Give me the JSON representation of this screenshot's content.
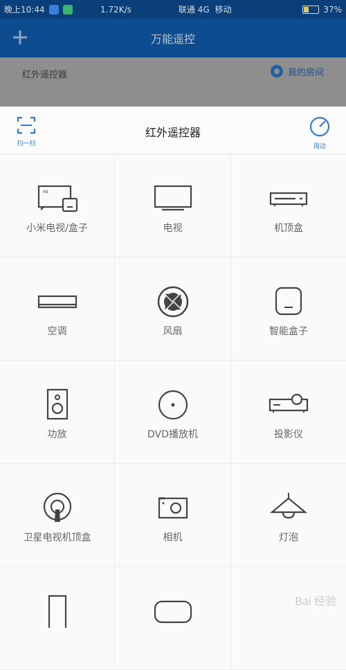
{
  "status_bar": {
    "time": "晚上10:44",
    "speed": "1.72K/s",
    "carrier1": "联通 4G",
    "carrier2": "移动",
    "battery": "37%",
    "battery_level": 0.37
  },
  "appbar": {
    "title": "万能遥控"
  },
  "subbar": {
    "title": "红外遥控器",
    "room_label": "我的房间"
  },
  "sheet": {
    "title": "红外遥控器",
    "scan_label": "扫一扫",
    "nearby_label": "周边"
  },
  "devices": [
    {
      "label": "小米电视/盒子",
      "icon": "mi-tv-box-icon"
    },
    {
      "label": "电视",
      "icon": "tv-icon"
    },
    {
      "label": "机顶盒",
      "icon": "set-top-box-icon"
    },
    {
      "label": "空调",
      "icon": "air-conditioner-icon"
    },
    {
      "label": "风扇",
      "icon": "fan-icon"
    },
    {
      "label": "智能盒子",
      "icon": "smart-box-icon"
    },
    {
      "label": "功放",
      "icon": "amplifier-icon"
    },
    {
      "label": "DVD播放机",
      "icon": "dvd-icon"
    },
    {
      "label": "投影仪",
      "icon": "projector-icon"
    },
    {
      "label": "卫星电视机顶盒",
      "icon": "satellite-icon"
    },
    {
      "label": "相机",
      "icon": "camera-icon"
    },
    {
      "label": "灯泡",
      "icon": "lamp-icon"
    },
    {
      "label": "",
      "icon": "phone-icon"
    },
    {
      "label": "",
      "icon": "router-icon"
    },
    {
      "label": "",
      "icon": "blank"
    }
  ],
  "watermark": "Bai 经验",
  "colors": {
    "accent": "#2f7ed1",
    "appbar": "#0c4c8f",
    "icon": "#444444"
  }
}
